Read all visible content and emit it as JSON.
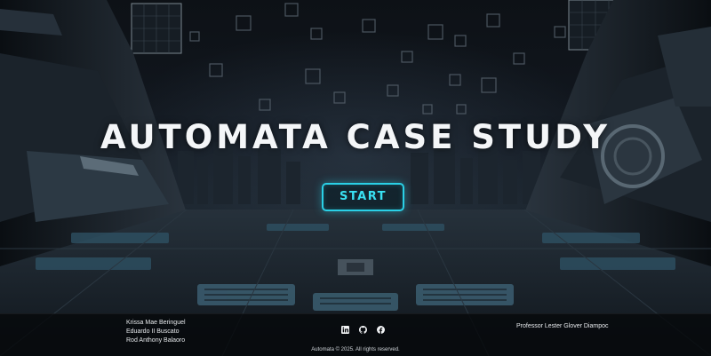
{
  "hero": {
    "title": "AUTOMATA CASE STUDY",
    "start_label": "START",
    "accent_color": "#2ad0e6"
  },
  "footer": {
    "members": [
      "Krissa Mae Beringuel",
      "Eduardo II Buscato",
      "Rod Anthony Balaoro"
    ],
    "professor": "Professor Lester Glover Diampoc",
    "socials": [
      {
        "icon": "linkedin-icon"
      },
      {
        "icon": "github-icon"
      },
      {
        "icon": "facebook-icon"
      }
    ],
    "copyright": "Automata © 2025. All rights reserved."
  }
}
